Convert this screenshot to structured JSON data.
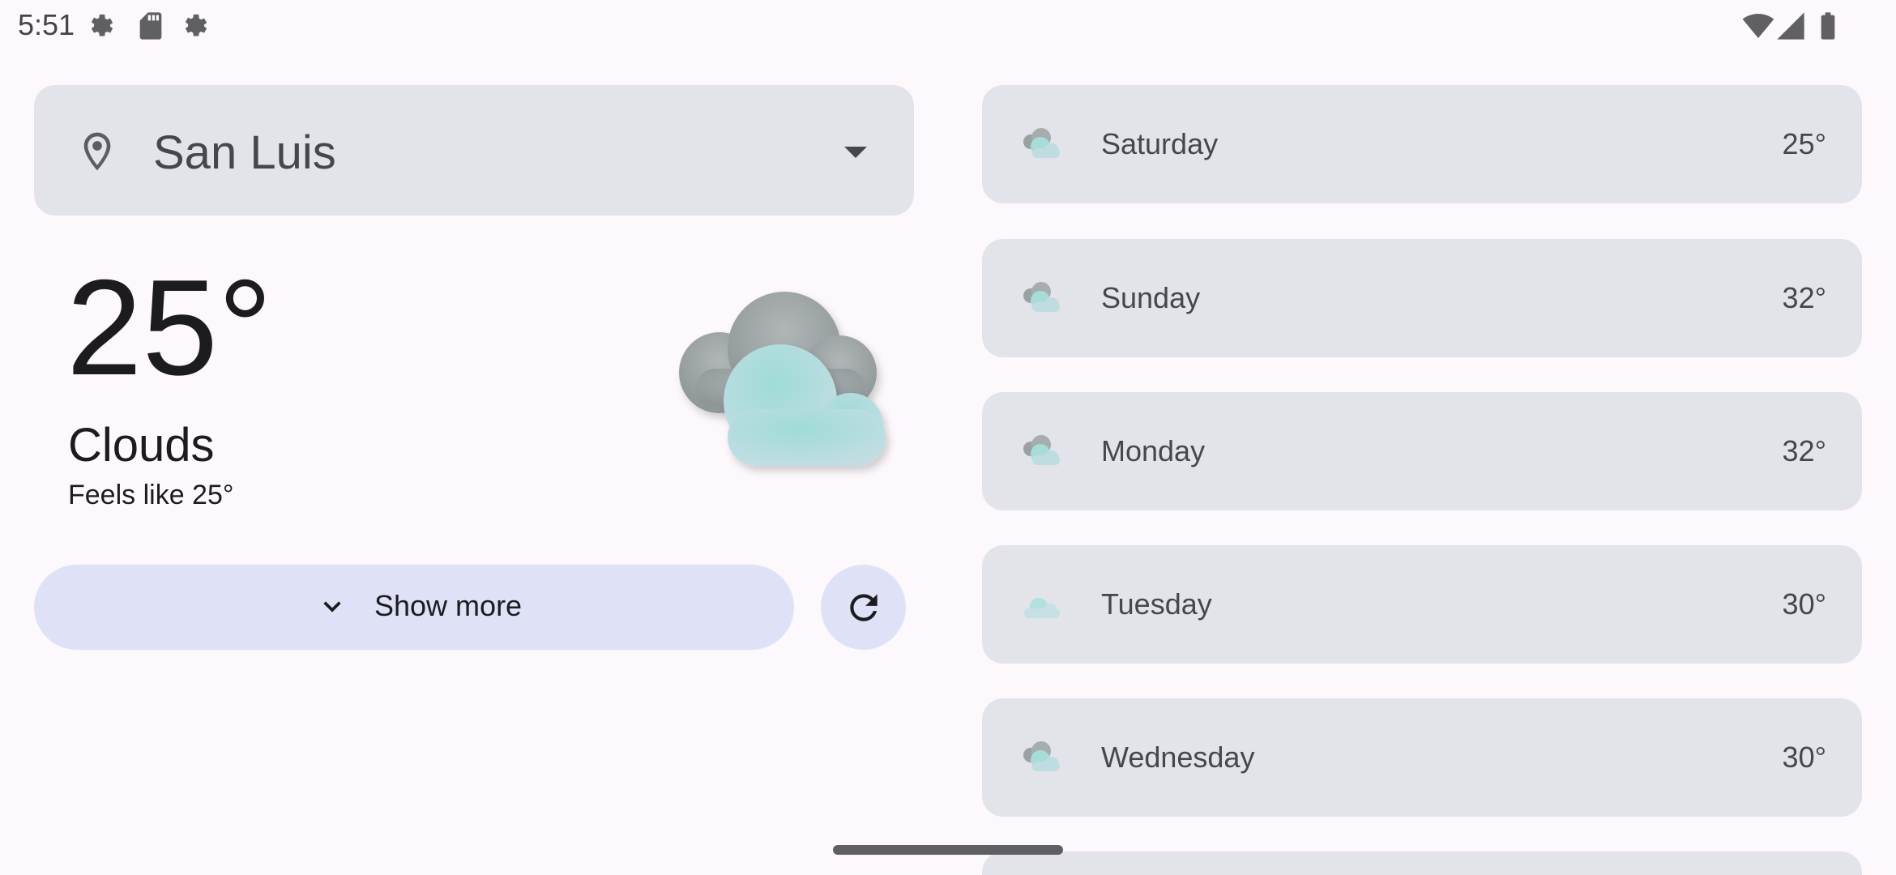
{
  "status_bar": {
    "time": "5:51",
    "left_icons": [
      "settings-gear-icon",
      "sd-card-icon",
      "settings-gear-icon"
    ],
    "right_icons": [
      "wifi-icon",
      "cell-signal-icon",
      "battery-icon"
    ]
  },
  "location": {
    "icon": "location-pin-icon",
    "name": "San Luis",
    "dropdown_icon": "arrow-drop-down-icon"
  },
  "current": {
    "temperature": "25°",
    "condition": "Clouds",
    "feels_like": "Feels like 25°",
    "icon": "cloud-icon"
  },
  "actions": {
    "show_more_label": "Show more",
    "show_more_icon": "chevron-down-icon",
    "refresh_icon": "refresh-icon"
  },
  "forecast": [
    {
      "day": "Saturday",
      "temp": "25°",
      "icon": "clouds-icon"
    },
    {
      "day": "Sunday",
      "temp": "32°",
      "icon": "clouds-icon"
    },
    {
      "day": "Monday",
      "temp": "32°",
      "icon": "clouds-icon"
    },
    {
      "day": "Tuesday",
      "temp": "30°",
      "icon": "light-cloud-icon"
    },
    {
      "day": "Wednesday",
      "temp": "30°",
      "icon": "clouds-icon"
    }
  ],
  "colors": {
    "background": "#fcf8fc",
    "card": "#e3e3ea",
    "button": "#dfe2f6",
    "text_primary": "#1c1b1f",
    "text_secondary": "#46464d"
  }
}
